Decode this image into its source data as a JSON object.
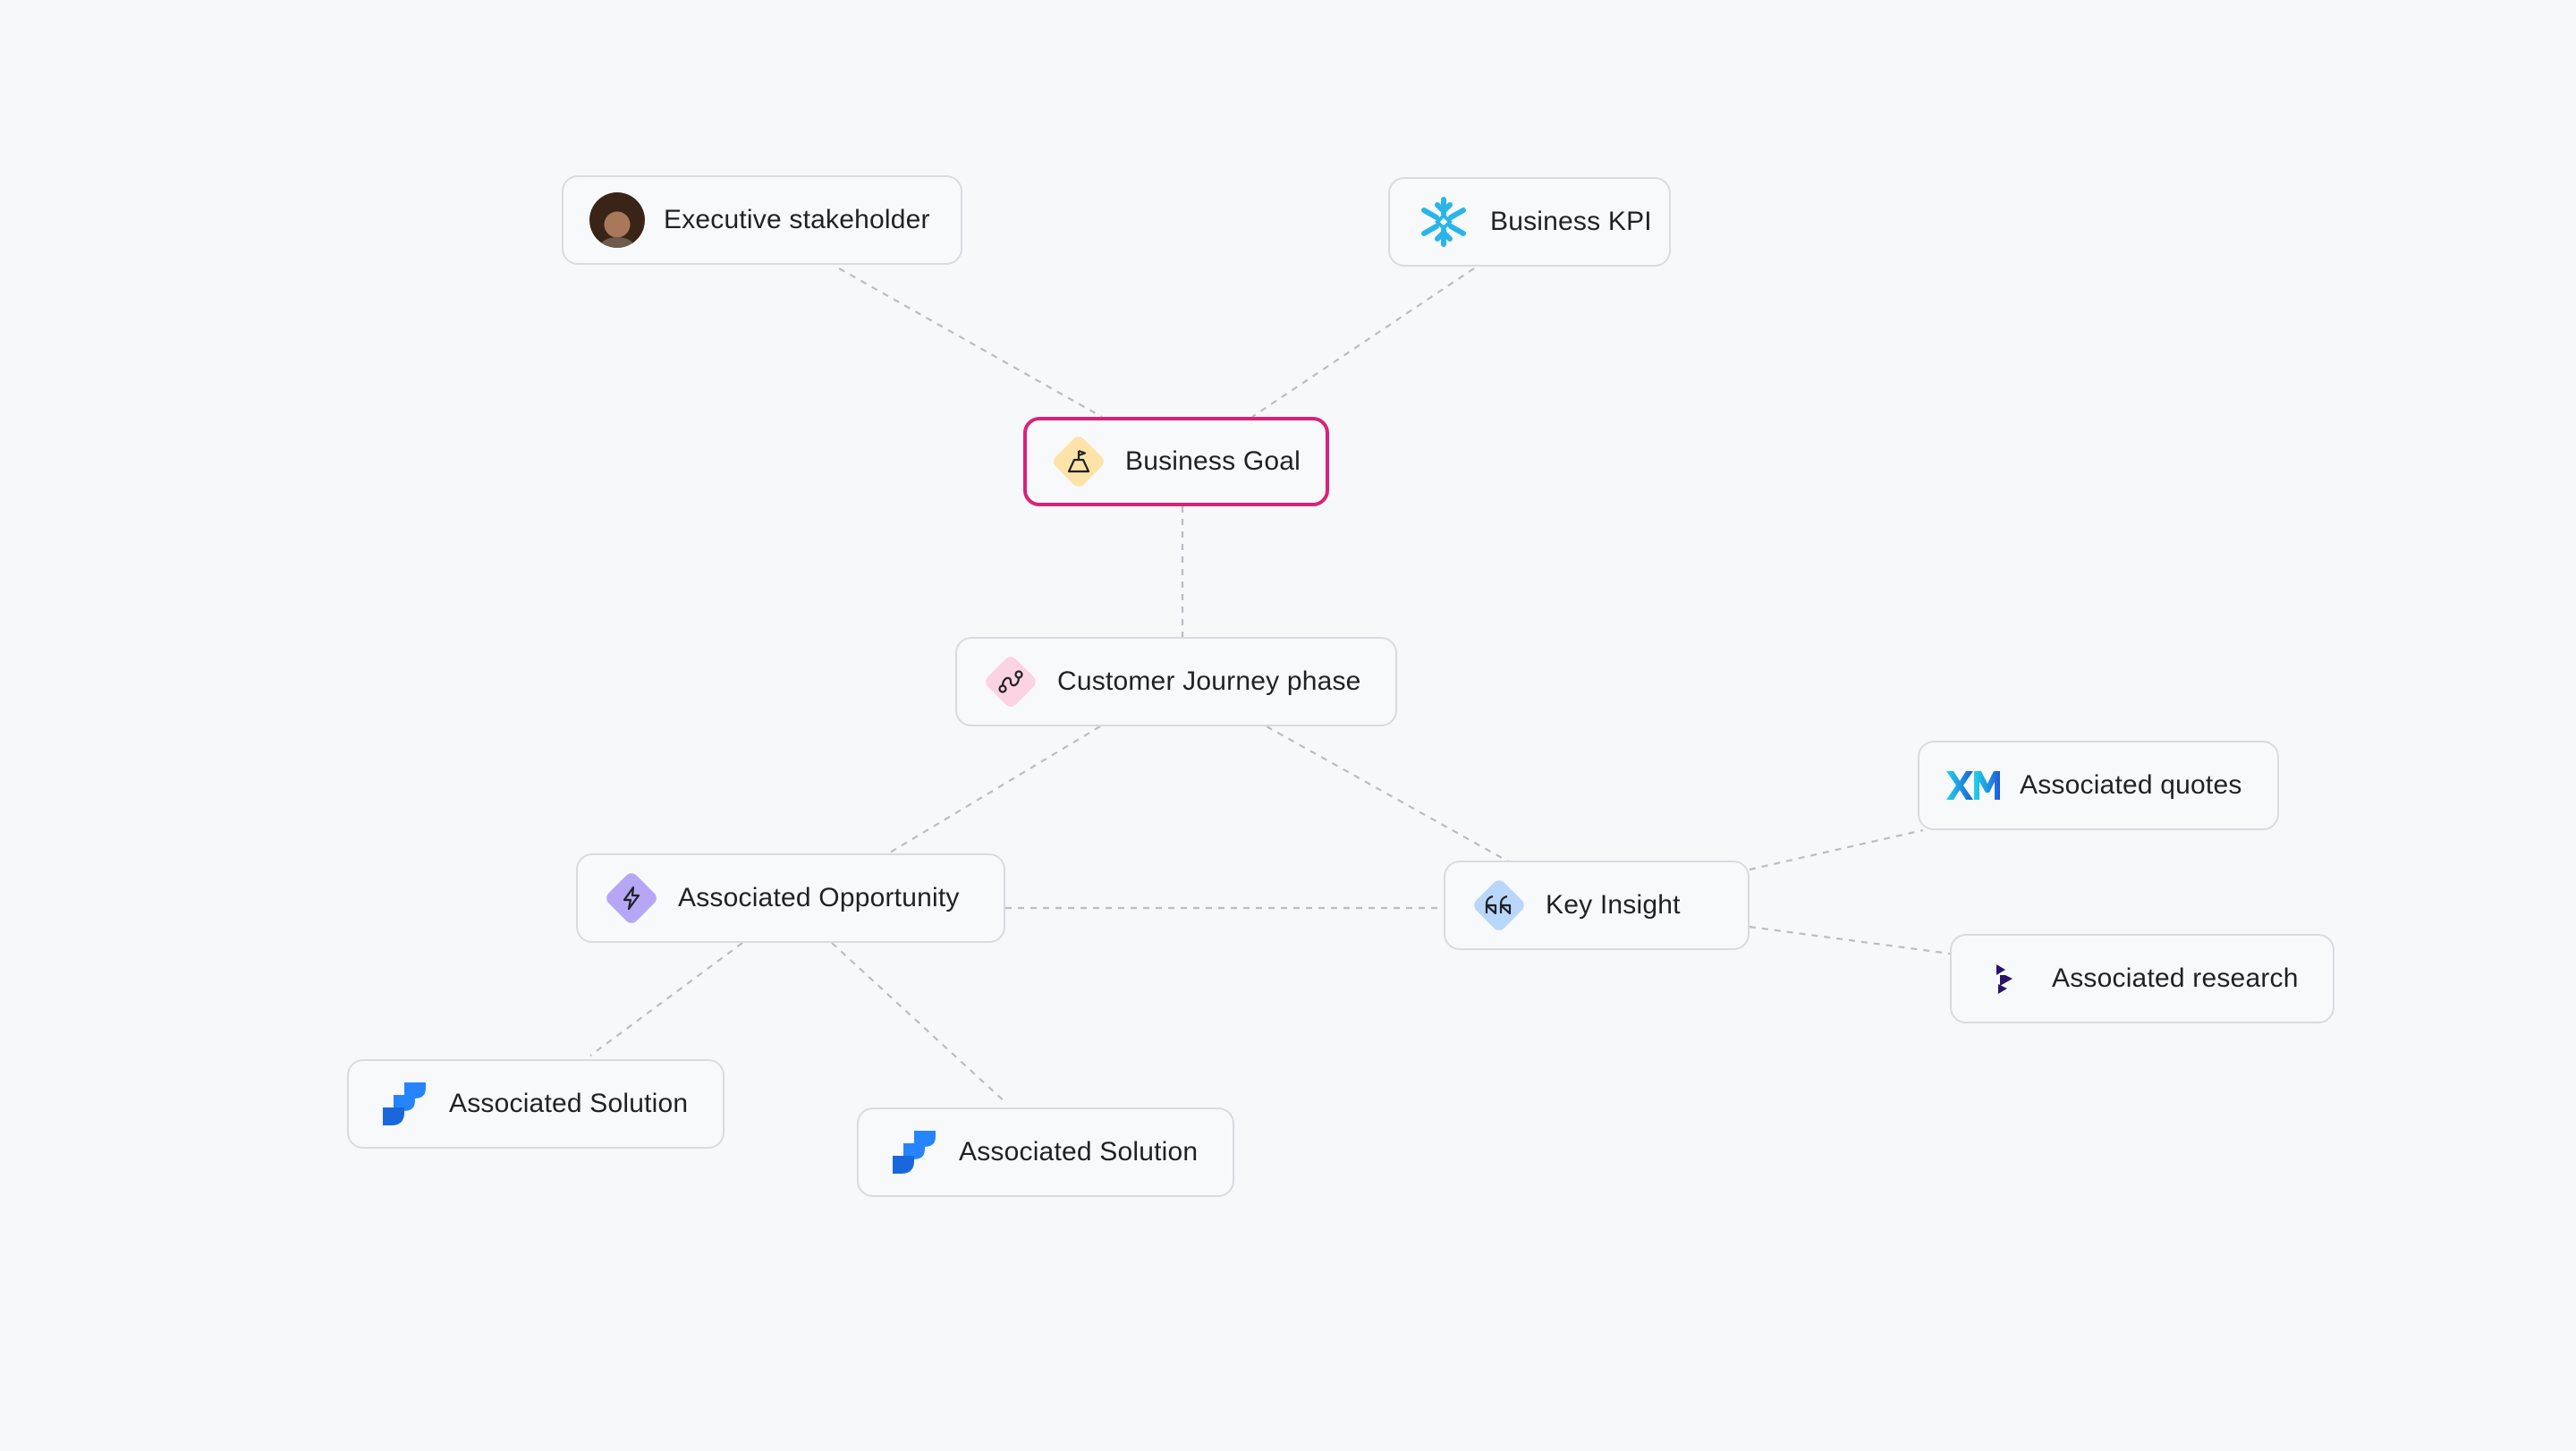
{
  "diagram": {
    "nodes": [
      {
        "id": "executive",
        "label": "Executive stakeholder",
        "icon": "avatar-icon"
      },
      {
        "id": "kpi",
        "label": "Business KPI",
        "icon": "snowflake-icon"
      },
      {
        "id": "goal",
        "label": "Business Goal",
        "icon": "goal-icon",
        "selected": true
      },
      {
        "id": "journey",
        "label": "Customer Journey phase",
        "icon": "journey-icon"
      },
      {
        "id": "opportunity",
        "label": "Associated Opportunity",
        "icon": "lightning-icon"
      },
      {
        "id": "insight",
        "label": "Key Insight",
        "icon": "quote-icon"
      },
      {
        "id": "quotes",
        "label": "Associated quotes",
        "icon": "xm-logo-icon"
      },
      {
        "id": "research",
        "label": "Associated research",
        "icon": "dovetail-logo-icon"
      },
      {
        "id": "solution1",
        "label": "Associated Solution",
        "icon": "jira-logo-icon"
      },
      {
        "id": "solution2",
        "label": "Associated Solution",
        "icon": "jira-logo-icon"
      }
    ],
    "edges": [
      [
        "executive",
        "goal"
      ],
      [
        "kpi",
        "goal"
      ],
      [
        "goal",
        "journey"
      ],
      [
        "journey",
        "opportunity"
      ],
      [
        "journey",
        "insight"
      ],
      [
        "opportunity",
        "insight"
      ],
      [
        "insight",
        "quotes"
      ],
      [
        "insight",
        "research"
      ],
      [
        "opportunity",
        "solution1"
      ],
      [
        "opportunity",
        "solution2"
      ]
    ],
    "colors": {
      "background": "#f7f8fa",
      "node_border": "#d8dbe0",
      "selected_border": "#d8227a",
      "connector": "#b9bdc4",
      "goal_icon_bg": "#fde3a7",
      "journey_icon_bg": "#fcd3e3",
      "opportunity_icon_bg": "#b7a6f5",
      "insight_icon_bg": "#b9d7fb",
      "snowflake": "#29b5e8",
      "jira": "#2684ff"
    }
  }
}
